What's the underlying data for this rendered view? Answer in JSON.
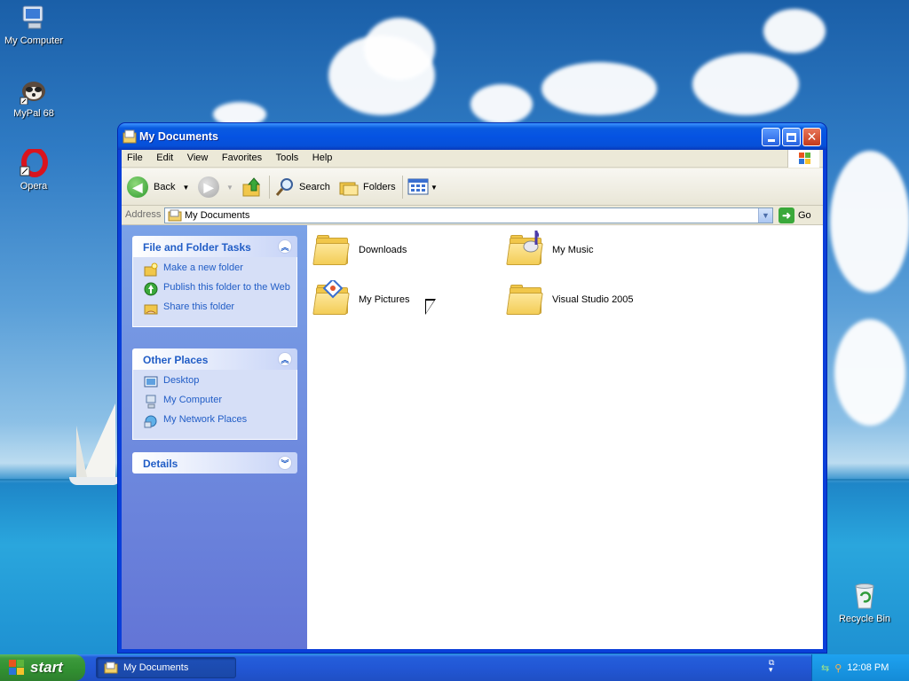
{
  "desktop": {
    "icons": [
      {
        "label": "My Computer",
        "icon": "my-computer-icon"
      },
      {
        "label": "MyPal 68",
        "icon": "mypal-icon"
      },
      {
        "label": "Opera",
        "icon": "opera-icon"
      },
      {
        "label": "Recycle Bin",
        "icon": "recycle-bin-icon"
      }
    ]
  },
  "window": {
    "title": "My Documents",
    "menu": [
      "File",
      "Edit",
      "View",
      "Favorites",
      "Tools",
      "Help"
    ],
    "toolbar": {
      "back": "Back",
      "search": "Search",
      "folders": "Folders"
    },
    "address": {
      "label": "Address",
      "value": "My Documents",
      "go": "Go"
    },
    "tasks_panel": {
      "title": "File and Folder Tasks",
      "items": [
        {
          "label": "Make a new folder",
          "icon": "new-folder-icon"
        },
        {
          "label": "Publish this folder to the Web",
          "icon": "publish-web-icon"
        },
        {
          "label": "Share this folder",
          "icon": "share-folder-icon"
        }
      ]
    },
    "places_panel": {
      "title": "Other Places",
      "items": [
        {
          "label": "Desktop",
          "icon": "desktop-icon"
        },
        {
          "label": "My Computer",
          "icon": "my-computer-icon"
        },
        {
          "label": "My Network Places",
          "icon": "network-places-icon"
        }
      ]
    },
    "details_panel": {
      "title": "Details"
    },
    "folders": [
      {
        "label": "Downloads",
        "icon": "folder-icon"
      },
      {
        "label": "My Music",
        "icon": "music-folder-icon"
      },
      {
        "label": "My Pictures",
        "icon": "pictures-folder-icon"
      },
      {
        "label": "Visual Studio 2005",
        "icon": "folder-icon"
      }
    ]
  },
  "taskbar": {
    "start": "start",
    "task_button": "My Documents",
    "clock": "12:08 PM"
  },
  "colors": {
    "titlebar": "#0553e3",
    "taskpane_link": "#215dc6",
    "start_green": "#3c9a3c"
  }
}
